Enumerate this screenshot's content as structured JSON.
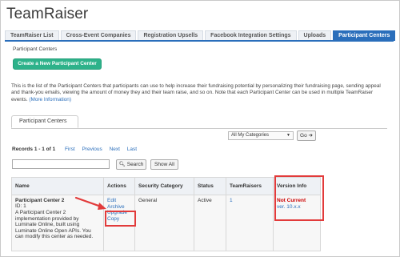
{
  "app_title": "TeamRaiser",
  "tabs": [
    {
      "label": "TeamRaiser List",
      "active": false
    },
    {
      "label": "Cross-Event Companies",
      "active": false
    },
    {
      "label": "Registration Upsells",
      "active": false
    },
    {
      "label": "Facebook Integration Settings",
      "active": false
    },
    {
      "label": "Uploads",
      "active": false
    },
    {
      "label": "Participant Centers",
      "active": true
    }
  ],
  "breadcrumb": "Participant Centers",
  "create_button": "Create a New Participant Center",
  "intro_text": "This is the list of the Participant Centers that participants can use to help increase their fundraising potential by personalizing their fundraising page, sending appeal and thank-you emails, viewing the amount of money they and their team raise, and so on. Note that each Participant Center can be used in multiple TeamRaiser events.",
  "intro_more": "(More Information)",
  "section_tab": "Participant Centers",
  "category_select": {
    "value": "All My Categories"
  },
  "go_button": "Go",
  "pager": {
    "count": "Records 1 - 1 of 1",
    "first": "First",
    "previous": "Previous",
    "next": "Next",
    "last": "Last"
  },
  "search": {
    "value": "",
    "placeholder": ""
  },
  "search_button": "Search",
  "show_all_button": "Show All",
  "table": {
    "headers": [
      "Name",
      "Actions",
      "Security Category",
      "Status",
      "TeamRaisers",
      "Version Info"
    ],
    "row": {
      "name": "Participant Center 2",
      "id": "ID: 1",
      "description": "A Participant Center 2 implementation provided by Luminate Online, built using Luminate Online Open APIs. You can modify this center as needed.",
      "actions": [
        "Edit",
        "Archive",
        "Upgrade",
        "Copy"
      ],
      "security_category": "General",
      "status": "Active",
      "teamraisers": "1",
      "version_status": "Not Current",
      "version": "ver. 10.x.x"
    }
  },
  "colors": {
    "accent": "#2a6ebb",
    "create_button": "#2db28a",
    "highlight": "#e23b3b",
    "not_current": "#cc0000"
  }
}
